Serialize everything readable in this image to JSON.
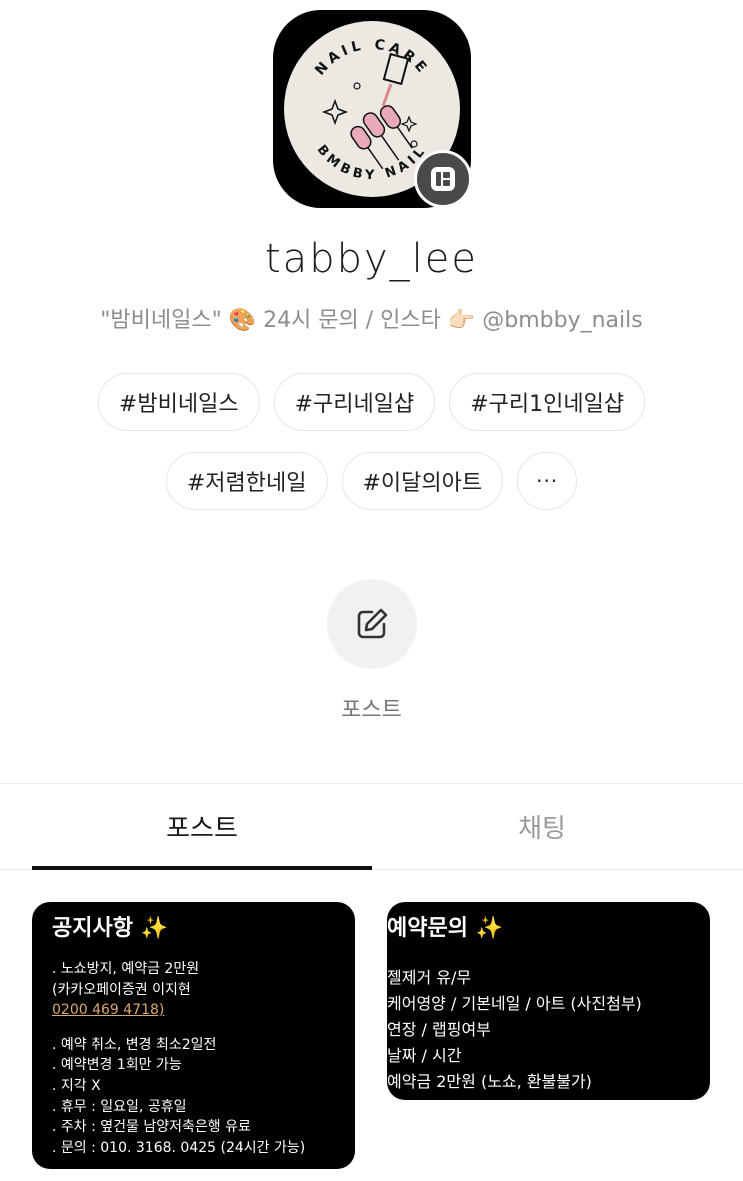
{
  "profile": {
    "logo_top_text": "NAIL CARE",
    "logo_bottom_text": "BMBBY NAIL",
    "username": "tabby_lee",
    "bio": "\"밤비네일스\" 🎨 24시 문의 / 인스타 👉🏻 @bmbby_nails"
  },
  "tags": {
    "row1": [
      "#밤비네일스",
      "#구리네일샵",
      "#구리1인네일샵"
    ],
    "row2": [
      "#저렴한네일",
      "#이달의아트"
    ],
    "more_label": "···"
  },
  "post_button": {
    "label": "포스트",
    "icon": "edit-icon"
  },
  "tabs": {
    "posts": "포스트",
    "chat": "채팅"
  },
  "cards": [
    {
      "title": "공지사항 ✨",
      "lines": [
        ". 노쇼방지, 예약금 2만원",
        "(카카오페이증권 이지현",
        "0200 469 4718)",
        "",
        ". 예약 취소, 변경 최소2일전",
        ". 예약변경 1회만 가능",
        ". 지각 X",
        ". 휴무 : 일요일, 공휴일",
        ". 주차 : 옆건물 남양저축은행 유료",
        ". 문의 : 010. 3168. 0425 (24시간 가능)"
      ]
    },
    {
      "title": "예약문의 ✨",
      "lines": [
        "젤제거 유/무",
        "케어영양 / 기본네일 / 아트 (사진첨부)",
        "연장 / 랩핑여부",
        "날짜 / 시간",
        "예약금 2만원 (노쇼, 환불불가)"
      ]
    }
  ],
  "colors": {
    "link": "#d9a86c",
    "card_bg": "#000000",
    "logo_bg": "#ece9e3",
    "nail_pink": "#e8a9b8"
  }
}
